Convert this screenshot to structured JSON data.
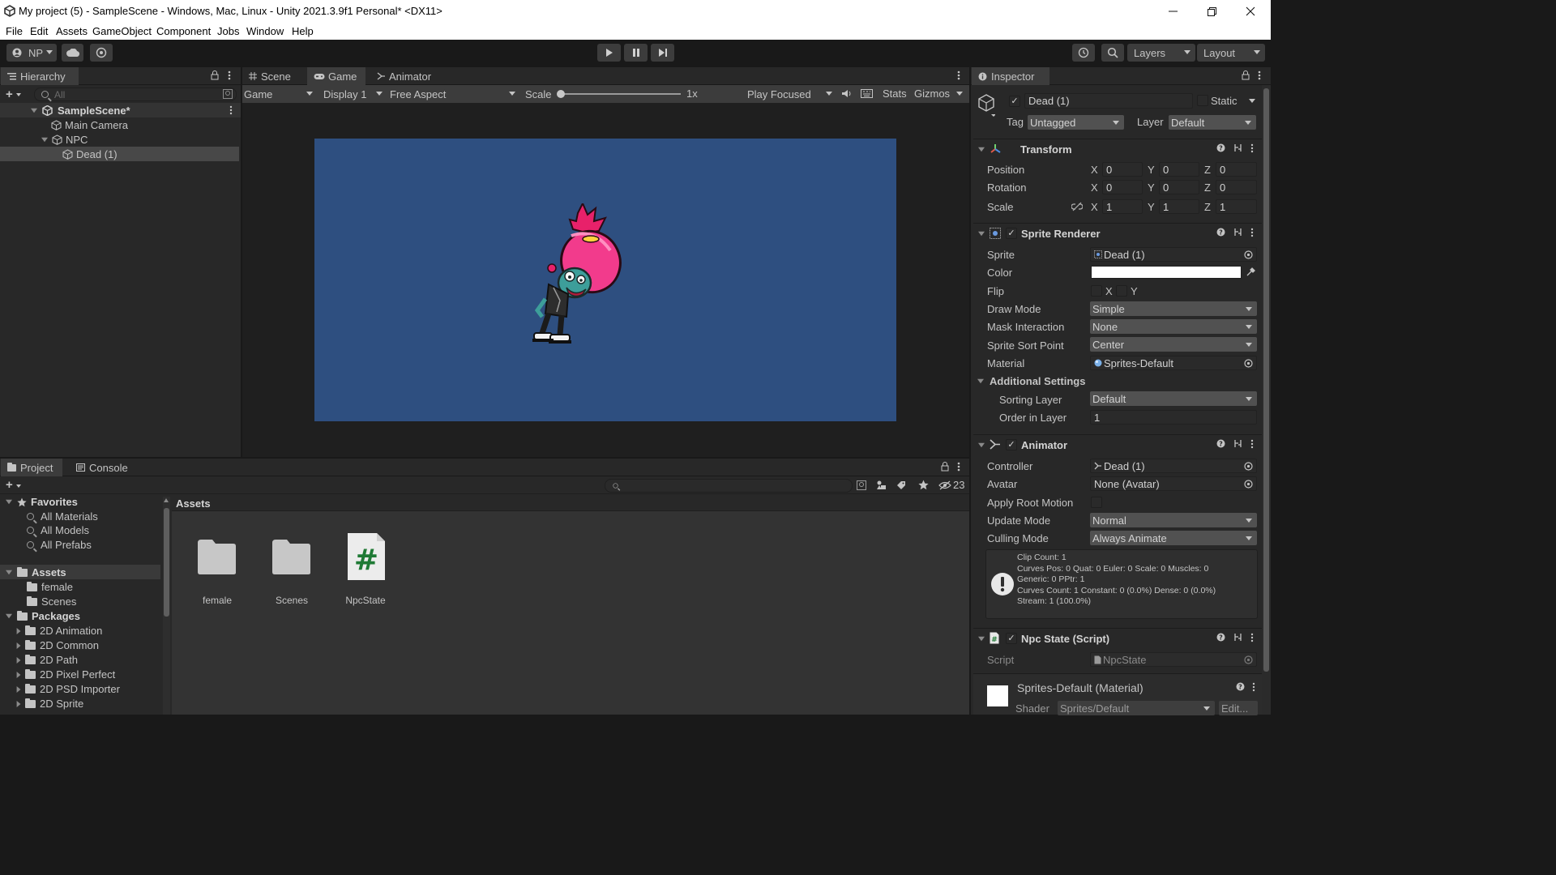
{
  "window": {
    "title": "My project (5) - SampleScene - Windows, Mac, Linux - Unity 2021.3.9f1 Personal* <DX11>"
  },
  "menu": [
    "File",
    "Edit",
    "Assets",
    "GameObject",
    "Component",
    "Jobs",
    "Window",
    "Help"
  ],
  "toolbar": {
    "account": "NP",
    "layers_label": "Layers",
    "layout_label": "Layout"
  },
  "hierarchy": {
    "tab_label": "Hierarchy",
    "search_placeholder": "All",
    "items": [
      {
        "label": "SampleScene*",
        "type": "scene"
      },
      {
        "label": "Main Camera",
        "type": "object"
      },
      {
        "label": "NPC",
        "type": "object"
      },
      {
        "label": "Dead (1)",
        "type": "object",
        "selected": true
      }
    ]
  },
  "center": {
    "tabs": [
      "Scene",
      "Game",
      "Animator"
    ],
    "active_tab": "Game",
    "controls": {
      "mode": "Game",
      "display": "Display 1",
      "aspect": "Free Aspect",
      "scale_label": "Scale",
      "scale_value": "1x",
      "play_mode": "Play Focused",
      "stats": "Stats",
      "gizmos": "Gizmos"
    },
    "game_background": "#2e4f80"
  },
  "project": {
    "tabs": [
      "Project",
      "Console"
    ],
    "asset_count": "23",
    "favorites_label": "Favorites",
    "favorites": [
      "All Materials",
      "All Models",
      "All Prefabs"
    ],
    "assets_label": "Assets",
    "asset_folders": [
      "female",
      "Scenes"
    ],
    "packages_label": "Packages",
    "packages": [
      "2D Animation",
      "2D Common",
      "2D Path",
      "2D Pixel Perfect",
      "2D PSD Importer",
      "2D Sprite"
    ],
    "breadcrumb": "Assets",
    "grid": [
      {
        "label": "female",
        "icon": "folder-icon"
      },
      {
        "label": "Scenes",
        "icon": "folder-icon"
      },
      {
        "label": "NpcState",
        "icon": "csharp-script-icon"
      }
    ]
  },
  "inspector": {
    "tab_label": "Inspector",
    "object_name": "Dead (1)",
    "static_label": "Static",
    "tag_label": "Tag",
    "tag_value": "Untagged",
    "layer_label": "Layer",
    "layer_value": "Default",
    "transform": {
      "title": "Transform",
      "position_label": "Position",
      "rotation_label": "Rotation",
      "scale_label": "Scale",
      "position": {
        "x": "0",
        "y": "0",
        "z": "0"
      },
      "rotation": {
        "x": "0",
        "y": "0",
        "z": "0"
      },
      "scale": {
        "x": "1",
        "y": "1",
        "z": "1"
      },
      "axis_x": "X",
      "axis_y": "Y",
      "axis_z": "Z"
    },
    "sprite_renderer": {
      "title": "Sprite Renderer",
      "sprite_label": "Sprite",
      "sprite_value": "Dead (1)",
      "color_label": "Color",
      "color_value": "#ffffff",
      "flip_label": "Flip",
      "flip_x": "X",
      "flip_y": "Y",
      "draw_mode_label": "Draw Mode",
      "draw_mode_value": "Simple",
      "mask_label": "Mask Interaction",
      "mask_value": "None",
      "sort_point_label": "Sprite Sort Point",
      "sort_point_value": "Center",
      "material_label": "Material",
      "material_value": "Sprites-Default",
      "additional_label": "Additional Settings",
      "sorting_layer_label": "Sorting Layer",
      "sorting_layer_value": "Default",
      "order_label": "Order in Layer",
      "order_value": "1"
    },
    "animator": {
      "title": "Animator",
      "controller_label": "Controller",
      "controller_value": "Dead (1)",
      "avatar_label": "Avatar",
      "avatar_value": "None (Avatar)",
      "root_motion_label": "Apply Root Motion",
      "update_label": "Update Mode",
      "update_value": "Normal",
      "culling_label": "Culling Mode",
      "culling_value": "Always Animate",
      "info_lines": [
        "Clip Count: 1",
        "Curves Pos: 0 Quat: 0 Euler: 0 Scale: 0 Muscles: 0",
        "Generic: 0 PPtr: 1",
        "Curves Count: 1 Constant: 0 (0.0%) Dense: 0 (0.0%)",
        "Stream: 1 (100.0%)"
      ]
    },
    "npc_state": {
      "title": "Npc State (Script)",
      "script_label": "Script",
      "script_value": "NpcState"
    },
    "material": {
      "title": "Sprites-Default (Material)",
      "shader_label": "Shader",
      "shader_value": "Sprites/Default",
      "edit_label": "Edit..."
    }
  }
}
